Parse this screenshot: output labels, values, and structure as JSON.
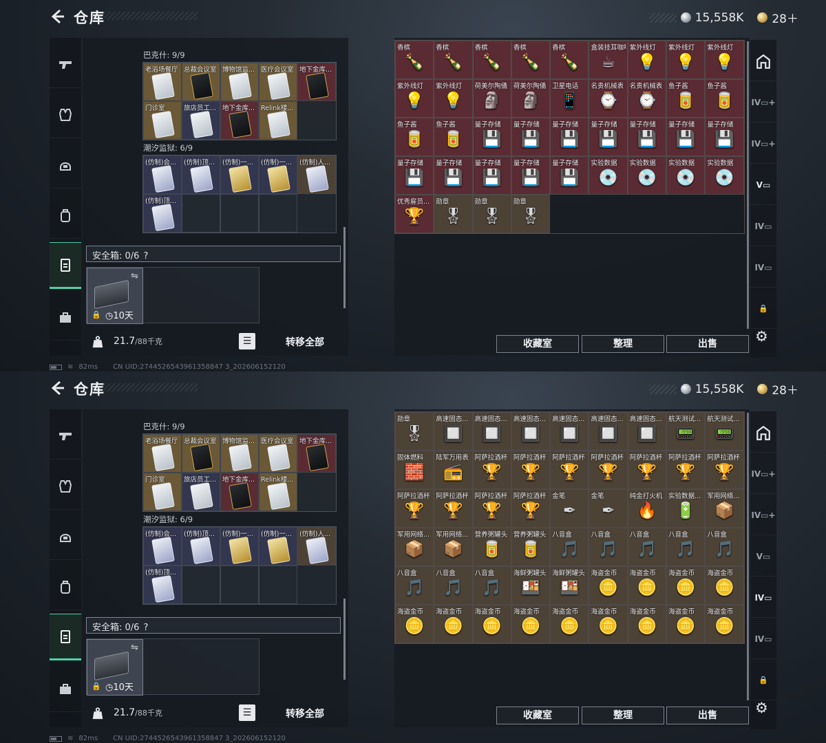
{
  "header": {
    "title": "仓库",
    "silver": "15,558K",
    "gold": "28＋"
  },
  "left": {
    "section1_label": "巴克什: 9/9",
    "section2_label": "潮汐监狱: 6/9",
    "bakeshi": [
      {
        "name": "老浴场餐厅",
        "bg": "gold",
        "icon": "white"
      },
      {
        "name": "总裁会议室",
        "bg": "gold",
        "icon": "black"
      },
      {
        "name": "博物馆监...",
        "bg": "gold",
        "icon": "white"
      },
      {
        "name": "医疗会议室",
        "bg": "gold",
        "icon": "white"
      },
      {
        "name": "地下金库...",
        "bg": "red",
        "icon": "black"
      },
      {
        "name": "门诊室",
        "bg": "gold",
        "icon": "white"
      },
      {
        "name": "旅店员工...",
        "bg": "purple",
        "icon": "white"
      },
      {
        "name": "地下金库...",
        "bg": "red",
        "icon": "black"
      },
      {
        "name": "Relink楼...",
        "bg": "gold",
        "icon": "white"
      }
    ],
    "tidal": [
      {
        "name": "(仿制)会...",
        "bg": "purple",
        "icon": "blue"
      },
      {
        "name": "(仿制)顶...",
        "bg": "purple",
        "icon": "blue"
      },
      {
        "name": "(仿制)一...",
        "bg": "purple",
        "icon": "gold"
      },
      {
        "name": "(仿制)一...",
        "bg": "purple",
        "icon": "gold"
      },
      {
        "name": "(仿制)人...",
        "bg": "brown",
        "icon": "blue"
      },
      {
        "name": "(仿制)顶...",
        "bg": "purple",
        "icon": "blue"
      },
      {
        "name": "",
        "bg": "empty",
        "icon": ""
      },
      {
        "name": "",
        "bg": "empty",
        "icon": ""
      },
      {
        "name": "",
        "bg": "empty",
        "icon": ""
      }
    ],
    "safe_label": "安全箱: 0/6",
    "safe_help": "?",
    "case_time": "10天",
    "weight_value": "21.7",
    "weight_max": "/88千克",
    "transfer_all": "转移全部"
  },
  "buttons": {
    "collection": "收藏室",
    "organize": "整理",
    "sell": "出售"
  },
  "status": {
    "ping": "82ms",
    "uid": "CN UID:2744526543961358847 3_202606152120"
  },
  "storage1": [
    {
      "name": "香槟",
      "icon": "🍾",
      "bg": "red"
    },
    {
      "name": "香槟",
      "icon": "🍾",
      "bg": "red"
    },
    {
      "name": "香槟",
      "icon": "🍾",
      "bg": "red"
    },
    {
      "name": "香槟",
      "icon": "🍾",
      "bg": "red"
    },
    {
      "name": "香槟",
      "icon": "🍾",
      "bg": "red"
    },
    {
      "name": "盒装挂耳咖啡",
      "icon": "☕",
      "bg": "red"
    },
    {
      "name": "紫外线灯",
      "icon": "💡",
      "bg": "red"
    },
    {
      "name": "紫外线灯",
      "icon": "💡",
      "bg": "red"
    },
    {
      "name": "紫外线灯",
      "icon": "💡",
      "bg": "red"
    },
    {
      "name": "紫外线灯",
      "icon": "💡",
      "bg": "red"
    },
    {
      "name": "紫外线灯",
      "icon": "💡",
      "bg": "red"
    },
    {
      "name": "荷美尔陶俑",
      "icon": "🗿",
      "bg": "red"
    },
    {
      "name": "荷美尔陶俑",
      "icon": "🗿",
      "bg": "red"
    },
    {
      "name": "卫星电话",
      "icon": "📱",
      "bg": "red"
    },
    {
      "name": "名贵机械表",
      "icon": "⌚",
      "bg": "red"
    },
    {
      "name": "名贵机械表",
      "icon": "⌚",
      "bg": "red"
    },
    {
      "name": "鱼子酱",
      "icon": "🥫",
      "bg": "red"
    },
    {
      "name": "鱼子酱",
      "icon": "🥫",
      "bg": "red"
    },
    {
      "name": "鱼子酱",
      "icon": "🥫",
      "bg": "red"
    },
    {
      "name": "鱼子酱",
      "icon": "🥫",
      "bg": "red"
    },
    {
      "name": "量子存储",
      "icon": "💾",
      "bg": "red"
    },
    {
      "name": "量子存储",
      "icon": "💾",
      "bg": "red"
    },
    {
      "name": "量子存储",
      "icon": "💾",
      "bg": "red"
    },
    {
      "name": "量子存储",
      "icon": "💾",
      "bg": "red"
    },
    {
      "name": "量子存储",
      "icon": "💾",
      "bg": "red"
    },
    {
      "name": "量子存储",
      "icon": "💾",
      "bg": "red"
    },
    {
      "name": "量子存储",
      "icon": "💾",
      "bg": "red"
    },
    {
      "name": "量子存储",
      "icon": "💾",
      "bg": "red"
    },
    {
      "name": "量子存储",
      "icon": "💾",
      "bg": "red"
    },
    {
      "name": "量子存储",
      "icon": "💾",
      "bg": "red"
    },
    {
      "name": "量子存储",
      "icon": "💾",
      "bg": "red"
    },
    {
      "name": "量子存储",
      "icon": "💾",
      "bg": "red"
    },
    {
      "name": "实验数据",
      "icon": "💿",
      "bg": "red"
    },
    {
      "name": "实验数据",
      "icon": "💿",
      "bg": "red"
    },
    {
      "name": "实验数据",
      "icon": "💿",
      "bg": "red"
    },
    {
      "name": "实验数据",
      "icon": "💿",
      "bg": "red"
    },
    {
      "name": "优秀雇员...",
      "icon": "🏆",
      "bg": "red"
    },
    {
      "name": "勋章",
      "icon": "🎖",
      "bg": "brown"
    },
    {
      "name": "勋章",
      "icon": "🎖",
      "bg": "brown"
    },
    {
      "name": "勋章",
      "icon": "🎖",
      "bg": "brown"
    }
  ],
  "storage2": [
    {
      "name": "勋章",
      "icon": "🎖",
      "bg": "brown"
    },
    {
      "name": "高速固态...",
      "icon": "🔲",
      "bg": "brown"
    },
    {
      "name": "高速固态...",
      "icon": "🔲",
      "bg": "brown"
    },
    {
      "name": "高速固态...",
      "icon": "🔲",
      "bg": "brown"
    },
    {
      "name": "高速固态...",
      "icon": "🔲",
      "bg": "brown"
    },
    {
      "name": "高速固态...",
      "icon": "🔲",
      "bg": "brown"
    },
    {
      "name": "高速固态...",
      "icon": "🔲",
      "bg": "brown"
    },
    {
      "name": "航天测试...",
      "icon": "📟",
      "bg": "brown"
    },
    {
      "name": "航天测试...",
      "icon": "📟",
      "bg": "brown"
    },
    {
      "name": "固体燃料",
      "icon": "🧱",
      "bg": "brown"
    },
    {
      "name": "陆军万用表",
      "icon": "📻",
      "bg": "brown"
    },
    {
      "name": "阿萨拉酒杯",
      "icon": "🏆",
      "bg": "brown"
    },
    {
      "name": "阿萨拉酒杯",
      "icon": "🏆",
      "bg": "brown"
    },
    {
      "name": "阿萨拉酒杯",
      "icon": "🏆",
      "bg": "brown"
    },
    {
      "name": "阿萨拉酒杯",
      "icon": "🏆",
      "bg": "brown"
    },
    {
      "name": "阿萨拉酒杯",
      "icon": "🏆",
      "bg": "brown"
    },
    {
      "name": "阿萨拉酒杯",
      "icon": "🏆",
      "bg": "brown"
    },
    {
      "name": "阿萨拉酒杯",
      "icon": "🏆",
      "bg": "brown"
    },
    {
      "name": "阿萨拉酒杯",
      "icon": "🏆",
      "bg": "brown"
    },
    {
      "name": "阿萨拉酒杯",
      "icon": "🏆",
      "bg": "brown"
    },
    {
      "name": "阿萨拉酒杯",
      "icon": "🏆",
      "bg": "brown"
    },
    {
      "name": "阿萨拉酒杯",
      "icon": "🏆",
      "bg": "brown"
    },
    {
      "name": "金笔",
      "icon": "✒",
      "bg": "brown"
    },
    {
      "name": "金笔",
      "icon": "✒",
      "bg": "brown"
    },
    {
      "name": "纯金打火机",
      "icon": "🔥",
      "bg": "brown"
    },
    {
      "name": "实验数据...",
      "icon": "🔋",
      "bg": "brown"
    },
    {
      "name": "军用网络...",
      "icon": "📦",
      "bg": "brown"
    },
    {
      "name": "军用网络...",
      "icon": "📦",
      "bg": "brown"
    },
    {
      "name": "军用网络...",
      "icon": "📦",
      "bg": "brown"
    },
    {
      "name": "营养粥罐头",
      "icon": "🥫",
      "bg": "brown"
    },
    {
      "name": "营养粥罐头",
      "icon": "🥫",
      "bg": "brown"
    },
    {
      "name": "八音盒",
      "icon": "🎵",
      "bg": "brown"
    },
    {
      "name": "八音盒",
      "icon": "🎵",
      "bg": "brown"
    },
    {
      "name": "八音盒",
      "icon": "🎵",
      "bg": "brown"
    },
    {
      "name": "八音盒",
      "icon": "🎵",
      "bg": "brown"
    },
    {
      "name": "八音盒",
      "icon": "🎵",
      "bg": "brown"
    },
    {
      "name": "八音盒",
      "icon": "🎵",
      "bg": "brown"
    },
    {
      "name": "八音盒",
      "icon": "🎵",
      "bg": "brown"
    },
    {
      "name": "八音盒",
      "icon": "🎵",
      "bg": "brown"
    },
    {
      "name": "海鲜粥罐头",
      "icon": "🍱",
      "bg": "brown"
    },
    {
      "name": "海鲜粥罐头",
      "icon": "🍱",
      "bg": "brown"
    },
    {
      "name": "海盗金币",
      "icon": "🪙",
      "bg": "brown"
    },
    {
      "name": "海盗金币",
      "icon": "🪙",
      "bg": "brown"
    },
    {
      "name": "海盗金币",
      "icon": "🪙",
      "bg": "brown"
    },
    {
      "name": "海盗金币",
      "icon": "🪙",
      "bg": "brown"
    },
    {
      "name": "海盗金币",
      "icon": "🪙",
      "bg": "brown"
    },
    {
      "name": "海盗金币",
      "icon": "🪙",
      "bg": "brown"
    },
    {
      "name": "海盗金币",
      "icon": "🪙",
      "bg": "brown"
    },
    {
      "name": "海盗金币",
      "icon": "🪙",
      "bg": "brown"
    },
    {
      "name": "海盗金币",
      "icon": "🪙",
      "bg": "brown"
    },
    {
      "name": "海盗金币",
      "icon": "🪙",
      "bg": "brown"
    },
    {
      "name": "海盗金币",
      "icon": "🪙",
      "bg": "brown"
    },
    {
      "name": "海盗金币",
      "icon": "🪙",
      "bg": "brown"
    },
    {
      "name": "海盗金币",
      "icon": "🪙",
      "bg": "brown"
    }
  ],
  "colors": {
    "accent": "#4fd1a7",
    "red_cell": "#5b2b33",
    "brown_cell": "#4d4236",
    "gold_cell": "#6a5836",
    "purple_cell": "#33364f"
  },
  "right_tabs": [
    "IV",
    "IV",
    "V",
    "IV",
    "IV"
  ],
  "right_tabs_active": [
    3,
    4
  ]
}
